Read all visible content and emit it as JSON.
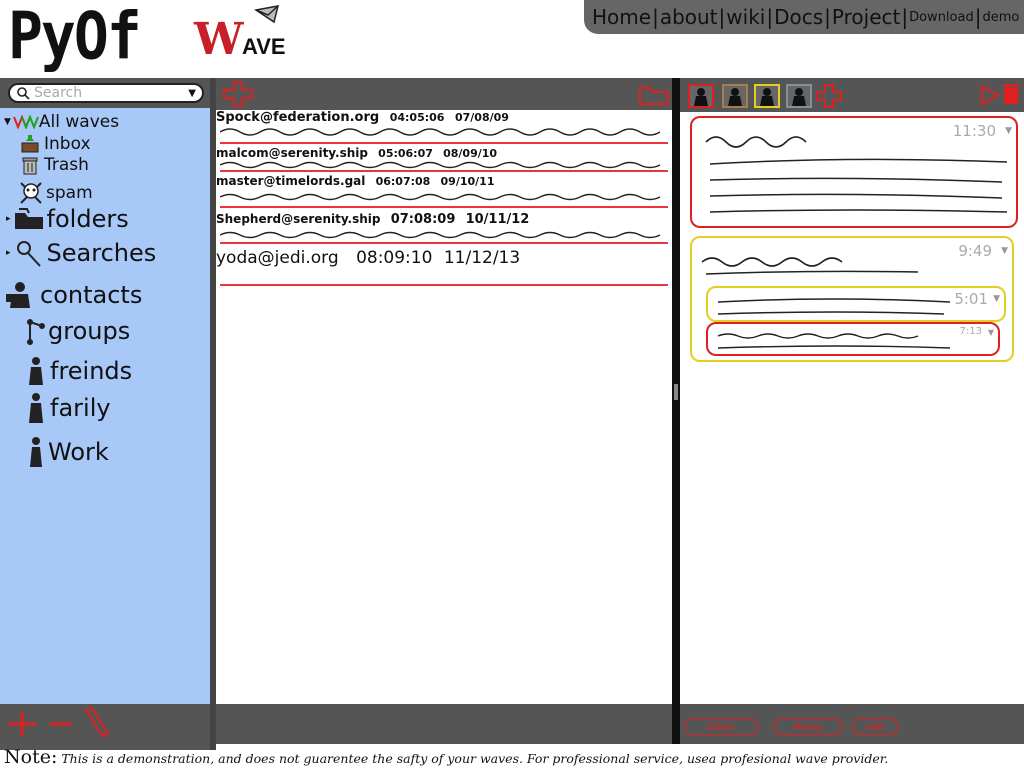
{
  "logo": {
    "name": "PyOf",
    "wave_initial": "W",
    "wave_rest": "AVE"
  },
  "topnav": {
    "links": [
      {
        "label": "Home"
      },
      {
        "label": "about"
      },
      {
        "label": "wiki"
      },
      {
        "label": "Docs"
      },
      {
        "label": "Project"
      },
      {
        "label": "Download"
      },
      {
        "label": "demo"
      }
    ]
  },
  "search": {
    "placeholder": "Search"
  },
  "sidebar": {
    "items": [
      {
        "label": "All waves",
        "icon": "wave-icon"
      },
      {
        "label": "Inbox",
        "icon": "inbox-icon"
      },
      {
        "label": "Trash",
        "icon": "trash-icon"
      },
      {
        "label": "spam",
        "icon": "skull-icon"
      },
      {
        "label": "folders",
        "icon": "folder-icon"
      },
      {
        "label": "Searches",
        "icon": "magnifier-icon"
      },
      {
        "label": "contacts",
        "icon": "contacts-icon"
      },
      {
        "label": "groups",
        "icon": "groups-icon"
      },
      {
        "label": "freinds",
        "icon": "person-icon"
      },
      {
        "label": "farily",
        "icon": "person-icon"
      },
      {
        "label": "Work",
        "icon": "person-icon"
      }
    ]
  },
  "waves": [
    {
      "from": "Spock@federation.org",
      "time": "04:05:06",
      "date": "07/08/09"
    },
    {
      "from": "malcom@serenity.ship",
      "time": "05:06:07",
      "date": "08/09/10"
    },
    {
      "from": "master@timelords.gal",
      "time": "06:07:08",
      "date": "09/10/11"
    },
    {
      "from": "Shepherd@serenity.ship",
      "time": "07:08:09",
      "date": "10/11/12"
    },
    {
      "from": "yoda@jedi.org",
      "time": "08:09:10",
      "date": "11/12/13"
    }
  ],
  "blips": [
    {
      "time": "11:30",
      "color": "#e02020"
    },
    {
      "time": "9:49",
      "color": "#e0d020"
    },
    {
      "time": "5:01",
      "color": "#e0d020"
    },
    {
      "time": "7:13",
      "color": "#e02020"
    }
  ],
  "bottom_buttons": [
    {
      "label": "Inbox"
    },
    {
      "label": "Reply"
    },
    {
      "label": "edit"
    }
  ],
  "footer": {
    "note_label": "Note:",
    "text": "This is a demonstration, and does not guarentee the safty of your waves. For professional service, usea profesional wave provider."
  },
  "colors": {
    "accent": "#e02020",
    "sidebar": "#a8c8f8",
    "bar": "#555555",
    "yellow": "#e0d020"
  }
}
